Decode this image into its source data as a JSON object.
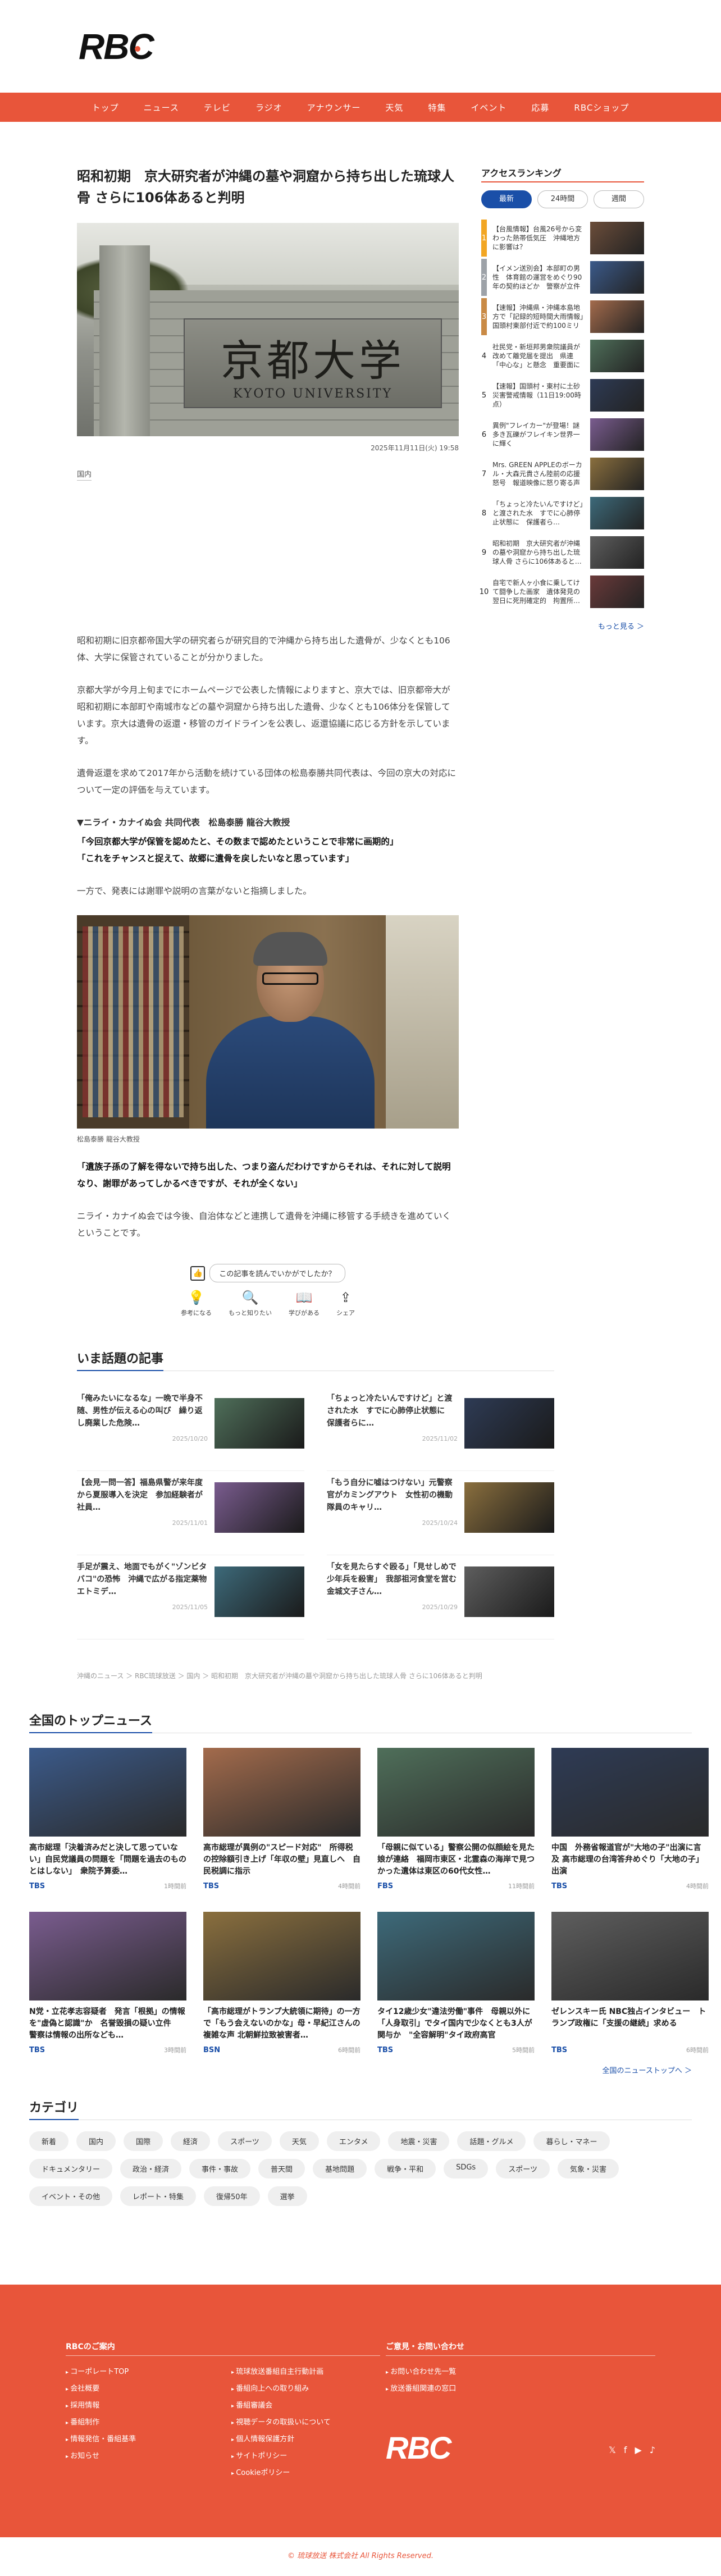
{
  "header": {
    "logo_text": "RBC",
    "nav": [
      "トップ",
      "ニュース",
      "テレビ",
      "ラジオ",
      "アナウンサー",
      "天気",
      "特集",
      "イベント",
      "応募",
      "RBCショップ"
    ]
  },
  "article": {
    "title": "昭和初期　京大研究者が沖縄の墓や洞窟から持ち出した琉球人骨 さらに106体あると判明",
    "hero_kanji": "京都大学",
    "hero_eng": "KYOTO UNIVERSITY",
    "datetime": "2025年11月11日(火) 19:58",
    "category": "国内",
    "paragraphs": [
      "昭和初期に旧京都帝国大学の研究者らが研究目的で沖縄から持ち出した遺骨が、少なくとも106体、大学に保管されていることが分かりました。",
      "京都大学が今月上旬までにホームページで公表した情報によりますと、京大では、旧京都帝大が昭和初期に本部町や南城市などの墓や洞窟から持ち出した遺骨、少なくとも106体分を保管しています。京大は遺骨の返還・移管のガイドラインを公表し、返還協議に応じる方針を示しています。",
      "遺骨返還を求めて2017年から活動を続けている団体の松島泰勝共同代表は、今回の京大の対応について一定の評価を与えています。"
    ],
    "quote_head": "▼ニライ・カナイぬ会 共同代表　松島泰勝 龍谷大教授",
    "quote1": "「今回京都大学が保管を認めたと、その数まで認めたということで非常に画期的」",
    "quote2": "「これをチャンスと捉えて、故郷に遺骨を戻したいなと思っています」",
    "para_after": "一方で、発表には謝罪や説明の言葉がないと指摘しました。",
    "photo2_caption": "松島泰勝 龍谷大教授",
    "quote3": "「遺族子孫の了解を得ないで持ち出した、つまり盗んだわけですからそれは、それに対して説明なり、謝罪があってしかるべきですが、それが全くない」",
    "para_last": "ニライ・カナイぬ会では今後、自治体などと連携して遺骨を沖縄に移管する手続きを進めていくということです。",
    "feedback_question": "この記事を読んでいかがでしたか？",
    "feedback_buttons": [
      "参考になる",
      "もっと知りたい",
      "学びがある",
      "シェア"
    ]
  },
  "sidebar": {
    "title": "アクセスランキング",
    "tabs": [
      "最新",
      "24時間",
      "週間"
    ],
    "items": [
      {
        "num": "1",
        "text": "【台風情報】台風26号から変わった熱帯低気圧　沖縄地方に影響は？",
        "color": "#f2a623"
      },
      {
        "num": "2",
        "text": "【イメン送別会】本部町の男性　体育館の運営をめぐり90年の契約ほどか　警察が立件",
        "color": "#9da2a8"
      },
      {
        "num": "3",
        "text": "【速報】沖縄県・沖縄本島地方で「記録的短時間大雨情報」　国頭村東部付近で約100ミリ",
        "color": "#c98a45"
      },
      {
        "num": "4",
        "text": "社民党・新垣邦男衆院議員が改めて離党届を提出　県連「中心な」と懸念　重要面に",
        "color": "#ffffff"
      },
      {
        "num": "5",
        "text": "【速報】国頭村・東村に土砂災害警戒情報（11日19:00時点）",
        "color": "#ffffff"
      },
      {
        "num": "6",
        "text": "異例\"フレイカー\"が登場！謎多き瓦礫がフレイキン世界一に輝く",
        "color": "#ffffff"
      },
      {
        "num": "7",
        "text": "Mrs. GREEN APPLEのボーカル・大森元貴さん陸前の応援怒号　報道映像に怒り寄る声の…",
        "color": "#ffffff"
      },
      {
        "num": "8",
        "text": "「ちょっと冷たいんですけど」と渡された水　すでに心肺停止状態に　保護者ら…",
        "color": "#ffffff"
      },
      {
        "num": "9",
        "text": "昭和初期　京大研究者が沖縄の墓や洞窟から持ち出した琉球人骨 さらに106体あると…",
        "color": "#ffffff"
      },
      {
        "num": "10",
        "text": "自宅で新人ヶ小食に乗してけて闘争した画家　遺体発見の翌日に死刑確定的　拘置所…",
        "color": "#ffffff"
      }
    ],
    "more": "もっと見る ＞"
  },
  "trending": {
    "title": "いま話題の記事",
    "items": [
      {
        "text": "「俺みたいになるな」一晩で半身不随、男性が伝える心の叫び　繰り返し廃業した危険…",
        "date": "2025/10/20"
      },
      {
        "text": "「ちょっと冷たいんですけど」と渡された水　すでに心肺停止状態に　保護者らに…",
        "date": "2025/11/02"
      },
      {
        "text": "【会見一問一答】福島県警が来年度から夏服導入を決定　参加経験者が社員…",
        "date": "2025/11/01"
      },
      {
        "text": "「もう自分に嘘はつけない」元警察官がカミングアウト　女性初の機動隊員のキャリ…",
        "date": "2025/10/24"
      },
      {
        "text": "手足が震え、地面でもがく\"ゾンビタバコ\"の恐怖　沖縄で広がる指定薬物エトミデ…",
        "date": "2025/11/05"
      },
      {
        "text": "「女を見たらすぐ殴る」「見せしめで少年兵を殺害」　我部祖河食堂を営む金城文子さん…",
        "date": "2025/10/29"
      }
    ]
  },
  "breadcrumb": "沖縄のニュース ＞ RBC琉球放送 ＞ 国内 ＞ 昭和初期　京大研究者が沖縄の墓や洞窟から持ち出した琉球人骨 さらに106体あると判明",
  "top_news": {
    "title": "全国のトップニュース",
    "items": [
      {
        "title": "高市総理「決着済みだと決して思っていない」自民党議員の問題を「問題を過去のものとはしない」　衆院予算委…",
        "src": "TBS",
        "time": "1時間前"
      },
      {
        "title": "高市総理が異例の\"スピード対応\"　所得税の控除額引き上げ「年収の壁」見直しへ　自民税調に指示",
        "src": "TBS",
        "time": "4時間前"
      },
      {
        "title": "「母親に似ている」警察公開の似顔絵を見た娘が連絡　福岡市東区・北霊森の海岸で見つかった遺体は東区の60代女性…",
        "src": "FBS",
        "time": "11時間前"
      },
      {
        "title": "中国　外務省報道官が\"大地の子\"出演に言及 高市総理の台湾答弁めぐり「大地の子」出演",
        "src": "TBS",
        "time": "4時間前"
      },
      {
        "title": "N党・立花孝志容疑者　発言「根拠」の情報を\"虚偽と認識\"か　名誉毀損の疑い立件　警察は情報の出所なども…",
        "src": "TBS",
        "time": "3時間前"
      },
      {
        "title": "「高市総理がトランプ大統領に期待」の一方で「もう会えないのかな」母・早紀江さんの複雑な声 北朝鮮拉致被害者…",
        "src": "BSN",
        "time": "6時間前"
      },
      {
        "title": "タイ12歳少女\"違法労働\"事件　母親以外に「人身取引」でタイ国内で少なくとも3人が関与か　\"全容解明\"タイ政府高官",
        "src": "TBS",
        "time": "5時間前"
      },
      {
        "title": "ゼレンスキー氏 NBC独占インタビュー　トランプ政権に「支援の継続」求める",
        "src": "TBS",
        "time": "6時間前"
      }
    ],
    "all_link": "全国のニューストップへ ＞"
  },
  "category": {
    "title": "カテゴリ",
    "items": [
      "新着",
      "国内",
      "国際",
      "経済",
      "スポーツ",
      "天気",
      "エンタメ",
      "地震・災害",
      "話題・グルメ",
      "暮らし・マネー",
      "ドキュメンタリー",
      "政治・経済",
      "事件・事故",
      "普天間",
      "基地問題",
      "戦争・平和",
      "SDGs",
      "スポーツ",
      "気象・災害",
      "イベント・その他",
      "レポート・特集",
      "復帰50年",
      "選挙"
    ]
  },
  "footer": {
    "col1_title": "RBCのご案内",
    "col1_a": [
      "コーポレートTOP",
      "会社概要",
      "採用情報",
      "番組制作",
      "情報発信・番組基準",
      "お知らせ"
    ],
    "col1_b": [
      "琉球放送番組自主行動計画",
      "番組向上への取り組み",
      "番組審議会",
      "視聴データの取扱いについて",
      "個人情報保護方針",
      "サイトポリシー",
      "Cookieポリシー"
    ],
    "col2_title": "ご意見・お問い合わせ",
    "col2": [
      "お問い合わせ先一覧",
      "放送番組関連の窓口"
    ],
    "logo": "RBC",
    "social": [
      "𝕏",
      "f",
      "▶",
      "♪"
    ],
    "copyright": "© 琉球放送 株式会社 All Rights Reserved."
  }
}
